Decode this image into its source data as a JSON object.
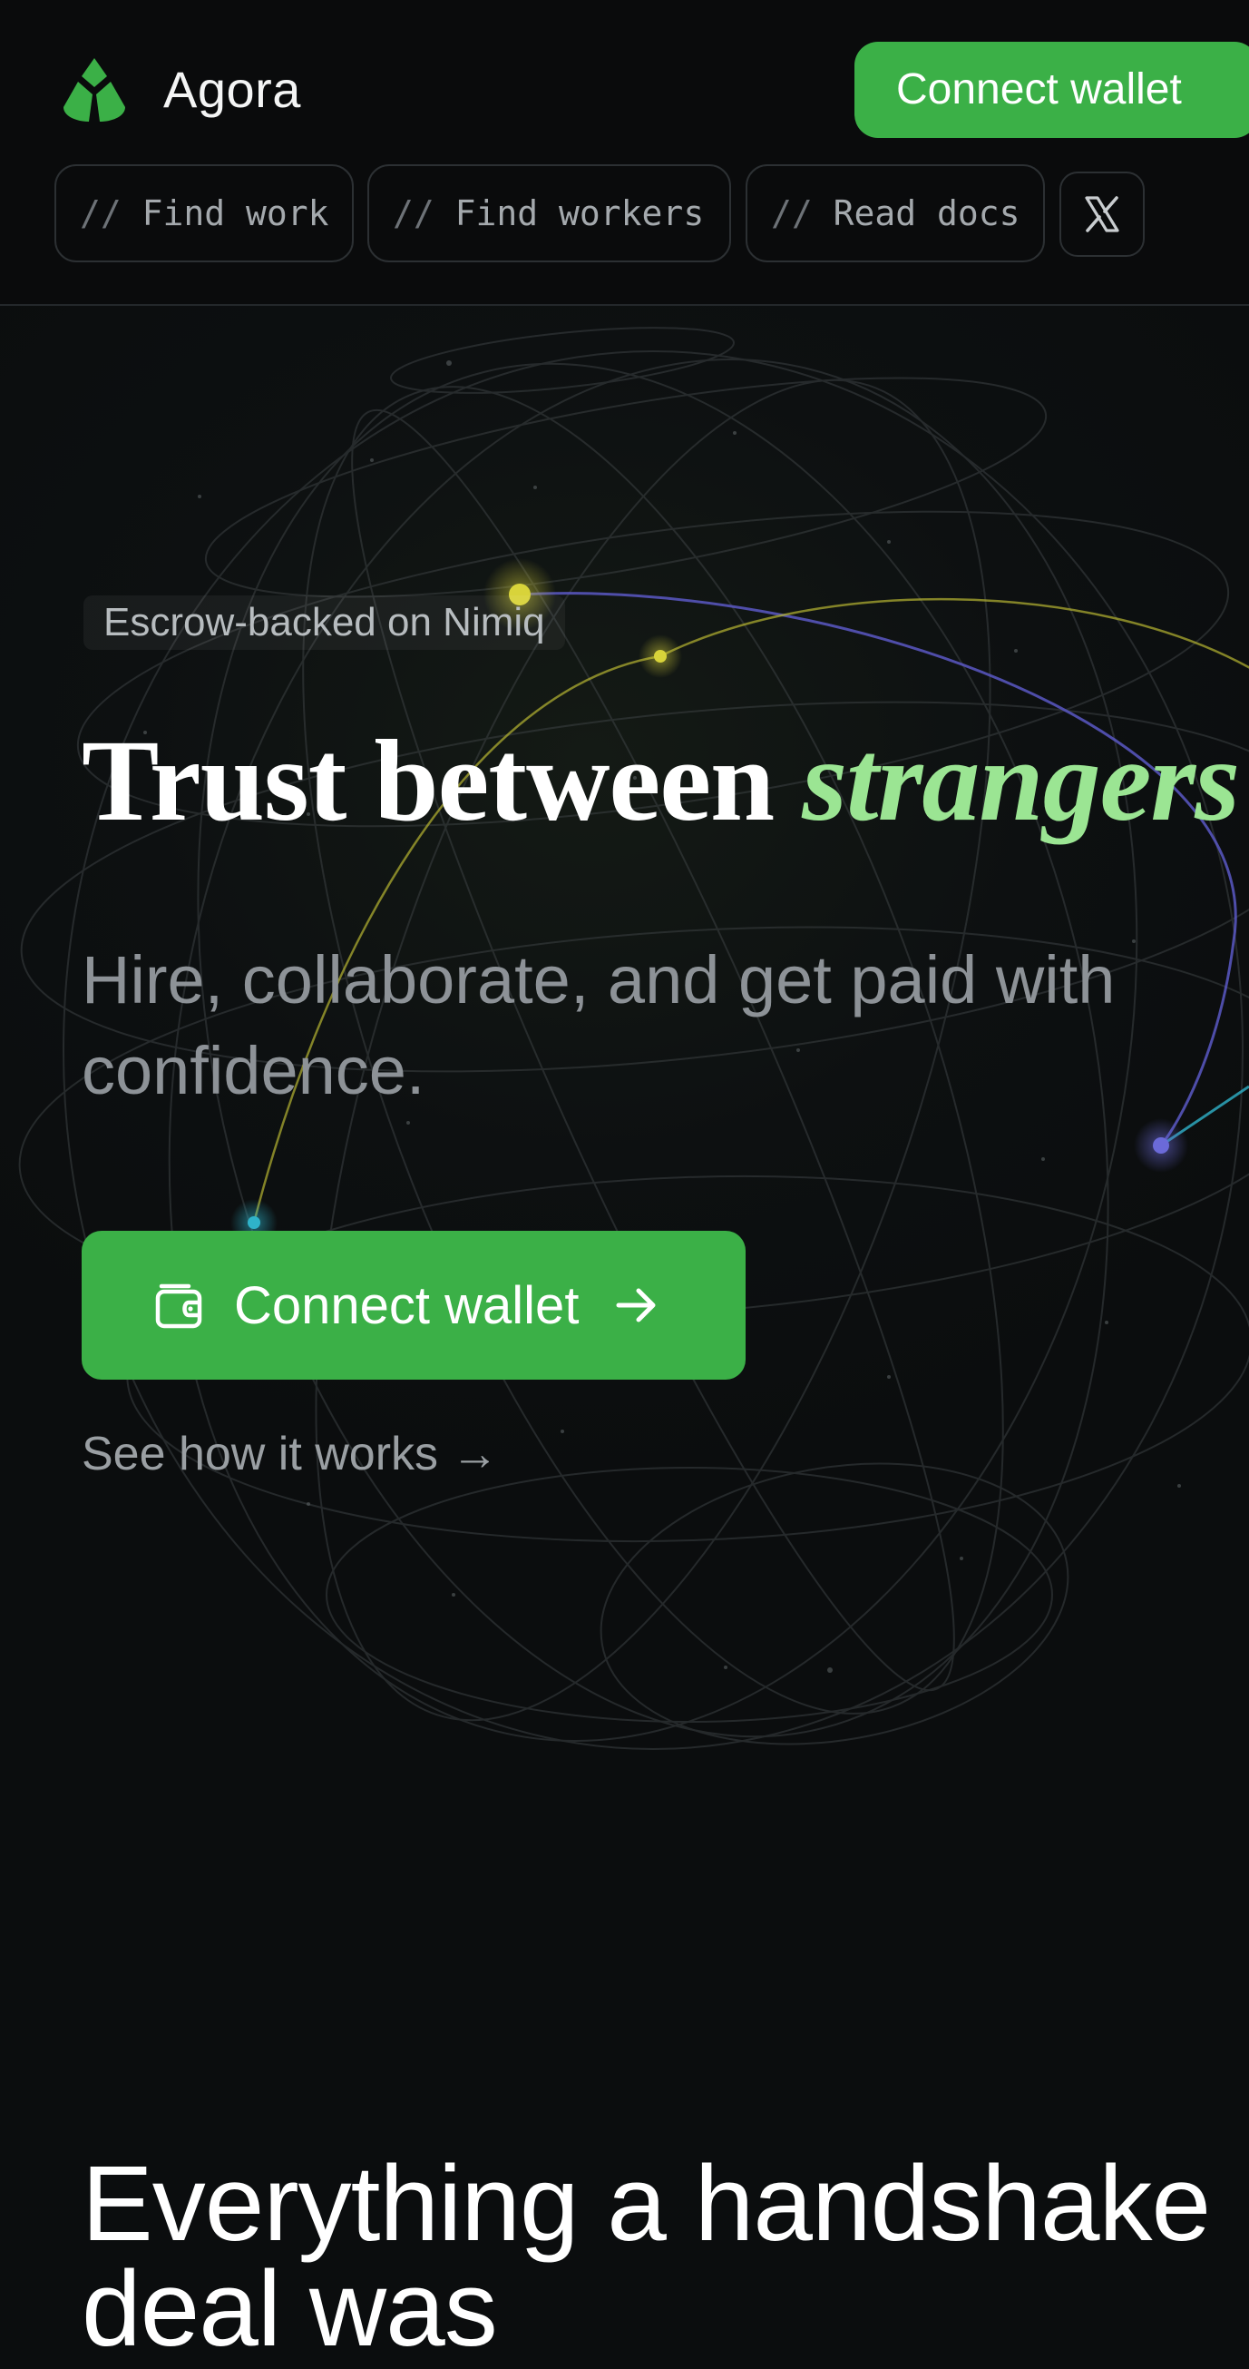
{
  "header": {
    "brand": "Agora",
    "connect_label": "Connect wallet",
    "nav": [
      {
        "prefix": "//",
        "label": "Find work"
      },
      {
        "prefix": "//",
        "label": "Find workers"
      },
      {
        "prefix": "//",
        "label": "Read docs"
      }
    ],
    "social_icon": "x-logo-icon"
  },
  "hero": {
    "eyebrow": "Escrow-backed on Nimiq",
    "title_main": "Trust between",
    "title_accent": "strangers",
    "subtitle": "Hire, collaborate, and get paid with confidence.",
    "cta_label": "Connect wallet",
    "cta_icons": [
      "wallet-icon",
      "arrow-right-icon"
    ],
    "secondary_link": "See how it works →"
  },
  "features": {
    "heading": "Everything a handshake deal was"
  },
  "colors": {
    "background": "#0b0d0e",
    "brand_green": "#3bb047",
    "accent_text": "#9be593",
    "muted_text": "#8d9297"
  }
}
